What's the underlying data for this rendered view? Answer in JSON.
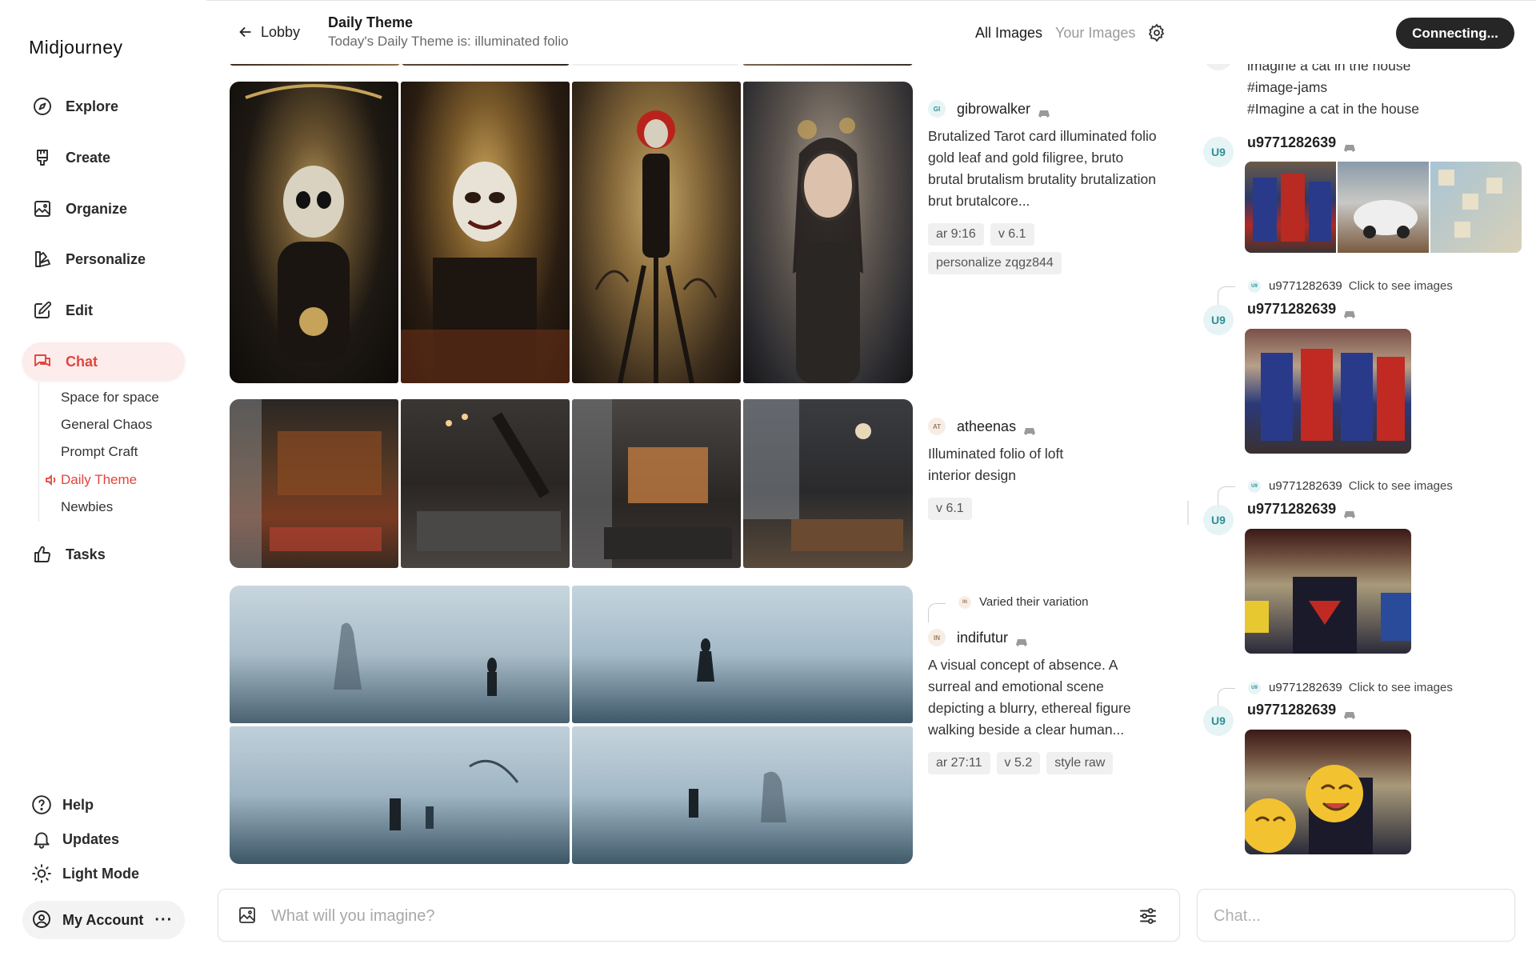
{
  "app": {
    "logo": "Midjourney"
  },
  "nav": {
    "items": [
      {
        "label": "Explore",
        "icon": "compass-icon"
      },
      {
        "label": "Create",
        "icon": "brush-icon"
      },
      {
        "label": "Organize",
        "icon": "image-icon"
      },
      {
        "label": "Personalize",
        "icon": "personalize-icon"
      },
      {
        "label": "Edit",
        "icon": "edit-icon"
      },
      {
        "label": "Chat",
        "icon": "chat-icon",
        "active": true
      },
      {
        "label": "Tasks",
        "icon": "thumbs-up-icon"
      }
    ],
    "chat_rooms": [
      {
        "label": "Space for space"
      },
      {
        "label": "General Chaos"
      },
      {
        "label": "Prompt Craft"
      },
      {
        "label": "Daily Theme",
        "active": true
      },
      {
        "label": "Newbies"
      }
    ],
    "bottom": [
      {
        "label": "Help",
        "icon": "help-icon"
      },
      {
        "label": "Updates",
        "icon": "bell-icon"
      },
      {
        "label": "Light Mode",
        "icon": "sun-icon"
      }
    ],
    "account": {
      "label": "My Account",
      "more": "···"
    }
  },
  "header": {
    "back_label": "Lobby",
    "title": "Daily Theme",
    "subtitle": "Today's Daily Theme is: illuminated folio",
    "filter_all": "All Images",
    "filter_yours": "Your Images",
    "status_button": "Connecting..."
  },
  "feed": [
    {
      "user": "gibrowalker",
      "badge": "GI",
      "prompt": "Brutalized Tarot card illuminated folio gold leaf and gold filigree, bruto brutal brutalism brutality brutalization brut brutalcore...",
      "params": [
        "ar 9:16",
        "v 6.1",
        "personalize zqgz844"
      ]
    },
    {
      "user": "atheenas",
      "badge": "AT",
      "prompt": "Illuminated folio of loft interior design",
      "params": [
        "v 6.1"
      ]
    },
    {
      "user": "indifutur",
      "badge": "IN",
      "varied_note": "Varied their variation",
      "prompt": "A visual concept of absence. A surreal and emotional scene depicting a blurry, ethereal figure walking beside a clear human...",
      "params": [
        "ar 27:11",
        "v 5.2",
        "style raw"
      ]
    }
  ],
  "chat": {
    "top_messages": [
      "imagine a cat in the house",
      "#image-jams",
      "#Imagine a cat in the house"
    ],
    "posts": [
      {
        "avatar": "U9",
        "user": "u9771282639"
      },
      {
        "avatar": "U9",
        "user": "u9771282639",
        "reply_user": "u9771282639",
        "reply_text": "Click to see images"
      },
      {
        "avatar": "U9",
        "user": "u9771282639",
        "reply_user": "u9771282639",
        "reply_text": "Click to see images"
      },
      {
        "avatar": "U9",
        "user": "u9771282639",
        "reply_user": "u9771282639",
        "reply_text": "Click to see images"
      }
    ]
  },
  "inputs": {
    "imagine_placeholder": "What will you imagine?",
    "chat_placeholder": "Chat..."
  },
  "colors": {
    "accent": "#e0463d",
    "active_bg": "#fdecec",
    "status_bg": "#262626",
    "avatar_teal": "#2d8f96"
  }
}
